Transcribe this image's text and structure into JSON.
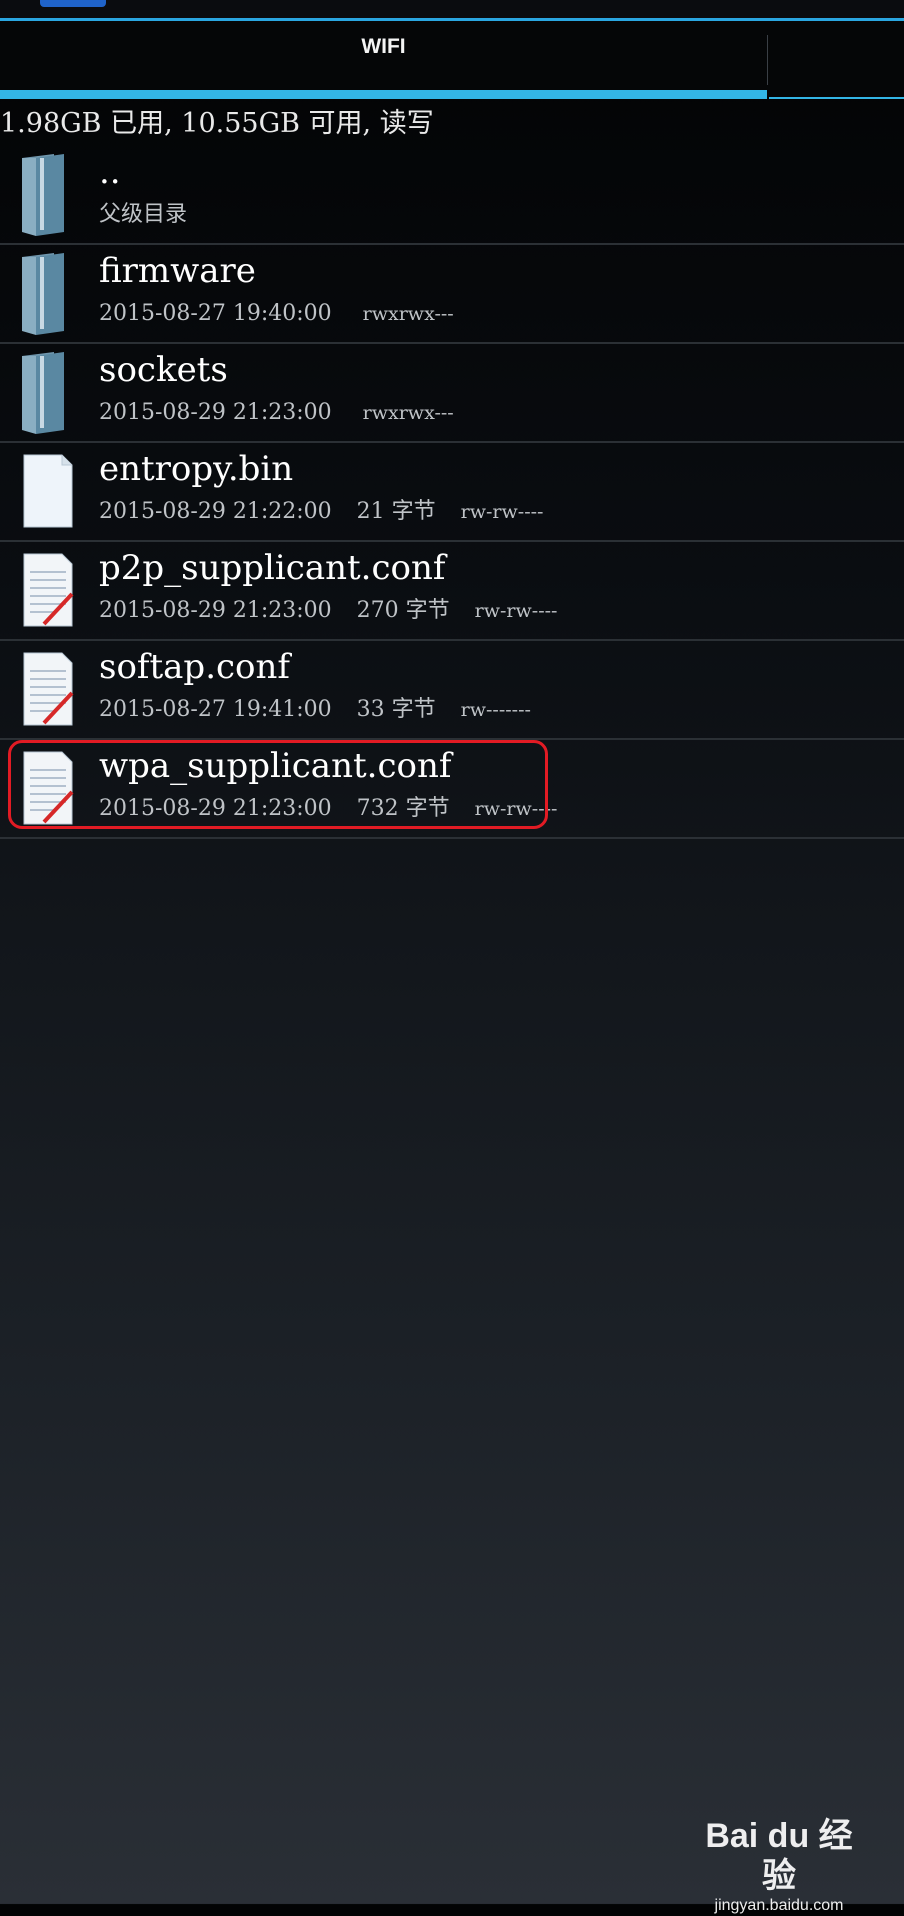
{
  "tabs": [
    {
      "label": "WIFI"
    }
  ],
  "storage_info": "1.98GB 已用, 10.55GB 可用, 读写",
  "files": [
    {
      "name": "..",
      "date": "父级目录",
      "size": "",
      "perm": "",
      "type": "folder"
    },
    {
      "name": "firmware",
      "date": "2015-08-27 19:40:00",
      "size": "",
      "perm": "rwxrwx---",
      "type": "folder"
    },
    {
      "name": "sockets",
      "date": "2015-08-29 21:23:00",
      "size": "",
      "perm": "rwxrwx---",
      "type": "folder"
    },
    {
      "name": "entropy.bin",
      "date": "2015-08-29 21:22:00",
      "size": "21 字节",
      "perm": "rw-rw----",
      "type": "file"
    },
    {
      "name": "p2p_supplicant.conf",
      "date": "2015-08-29 21:23:00",
      "size": "270 字节",
      "perm": "rw-rw----",
      "type": "text-file"
    },
    {
      "name": "softap.conf",
      "date": "2015-08-27 19:41:00",
      "size": "33 字节",
      "perm": "rw-------",
      "type": "text-file"
    },
    {
      "name": "wpa_supplicant.conf",
      "date": "2015-08-29 21:23:00",
      "size": "732 字节",
      "perm": "rw-rw----",
      "type": "text-file"
    }
  ],
  "highlighted_file": "wpa_supplicant.conf",
  "watermark": {
    "brand": "Bai du 经验",
    "url": "jingyan.baidu.com"
  },
  "colors": {
    "accent": "#33b5e5",
    "highlight": "#e21b24"
  }
}
